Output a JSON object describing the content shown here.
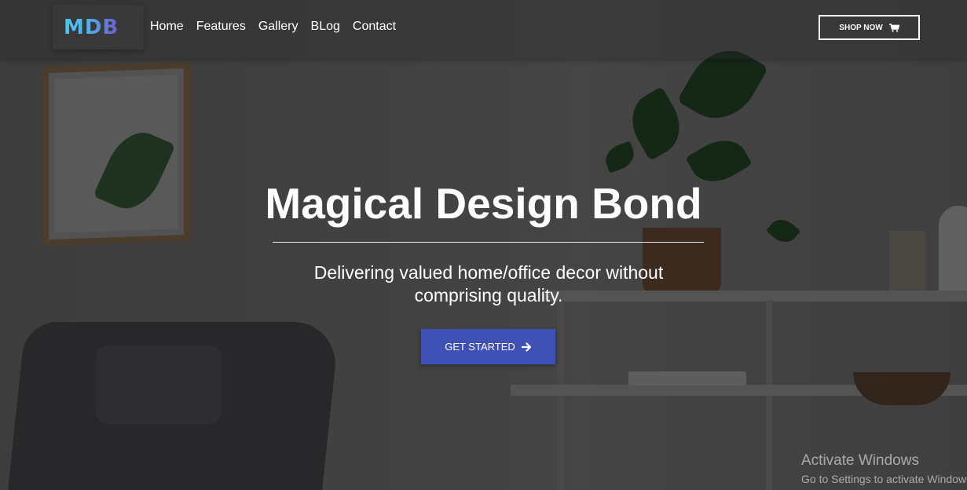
{
  "brand": {
    "logo_text": "MDB"
  },
  "nav": {
    "links": [
      "Home",
      "Features",
      "Gallery",
      "BLog",
      "Contact"
    ],
    "shop_button": "SHOP NOW"
  },
  "hero": {
    "title": "Magical Design Bond",
    "subtitle": "Delivering valued home/office decor without comprising quality.",
    "cta_label": "GET STARTED"
  },
  "watermark": {
    "title": "Activate Windows",
    "subtitle": "Go to Settings to activate Windows."
  },
  "icons": {
    "shop": "cart-icon",
    "cta": "arrow-right-icon"
  },
  "colors": {
    "primary": "#3f51b5",
    "logo_start": "#47c8f5",
    "logo_end": "#6f58d6"
  }
}
